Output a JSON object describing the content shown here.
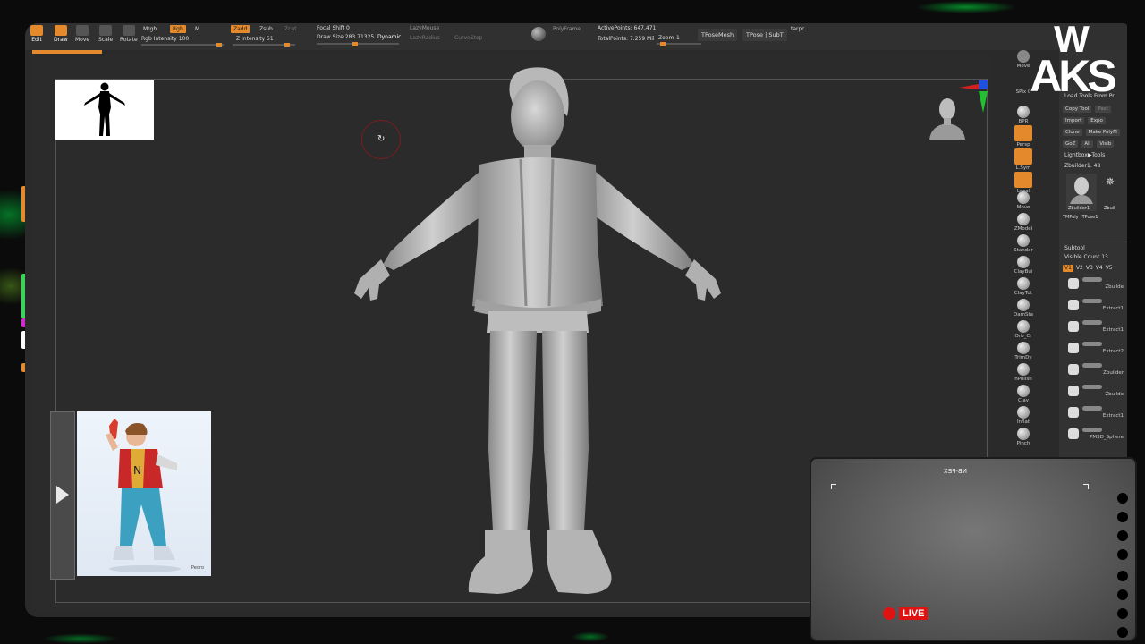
{
  "toolbar": {
    "tools": [
      {
        "label": "Edit",
        "active": true
      },
      {
        "label": "Draw",
        "active": true
      },
      {
        "label": "Move",
        "active": false
      },
      {
        "label": "Scale",
        "active": false
      },
      {
        "label": "Rotate",
        "active": false
      }
    ],
    "mrgb": "Mrgb",
    "rgb": "Rgb",
    "m": "M",
    "rgb_intensity": "Rgb Intensity 100",
    "zadd": "Zadd",
    "zsub": "Zsub",
    "zcut": "Zcut",
    "z_intensity": "Z Intensity 51",
    "focal_shift": "Focal Shift 0",
    "draw_size": "Draw Size 283.71325",
    "dynamic": "Dynamic",
    "lazymouse": "LazyMouse",
    "lazyradius": "LazyRadius",
    "curvestep": "CurveStep",
    "polyframe": "PolyFrame",
    "active_points": "ActivePoints: 647,471",
    "total_points": "TotalPoints: 7.259 Mil",
    "zoom": "Zoom",
    "zoom_value": "1",
    "tpose_mesh": "TPoseMesh",
    "tpose_subt": "TPose | SubT",
    "tarpos": "tarpc"
  },
  "right_column": {
    "buttons": [
      "Move",
      "SPix 0",
      "BPR",
      "Persp",
      "L.Sym",
      "Local",
      "Move",
      "ZModel",
      "Standar",
      "ClayBui",
      "ClayTut",
      "DamSta",
      "Orb_Cr",
      "TrimDy",
      "hPolish",
      "Clay",
      "Inflat",
      "Pinch"
    ]
  },
  "tool_panel": {
    "load_tools": "Load Tools From Pr",
    "copy_tool": "Copy Tool",
    "paste": "Past",
    "import": "Import",
    "export": "Expo",
    "clone": "Clone",
    "make_polymesh": "Make PolyM",
    "goz": "GoZ",
    "all": "All",
    "visible": "Visib",
    "lightbox_tools": "Lightbox▶Tools",
    "zbuilder": "Zbuilder1. 48",
    "thumb_label": "Zbuilder1",
    "thumb_label2": "Zbuil",
    "tmpoly": "TMPoly",
    "tpose": "TPose1",
    "subtool": "Subtool",
    "visible_count": "Visible Count 13",
    "v_buttons": [
      "V1",
      "V2",
      "V3",
      "V4",
      "V5"
    ],
    "subtools": [
      "Zbuilde",
      "Extract1",
      "Extract1",
      "Extract2",
      "Zbuilder",
      "Zbuilde",
      "Extract1",
      "PM3D_Sphere"
    ]
  },
  "reference_signature": "Pedro",
  "cam": {
    "label": "NB-PEX",
    "live": "LIVE"
  },
  "logo": {
    "text": "AKS",
    "w": "W"
  }
}
